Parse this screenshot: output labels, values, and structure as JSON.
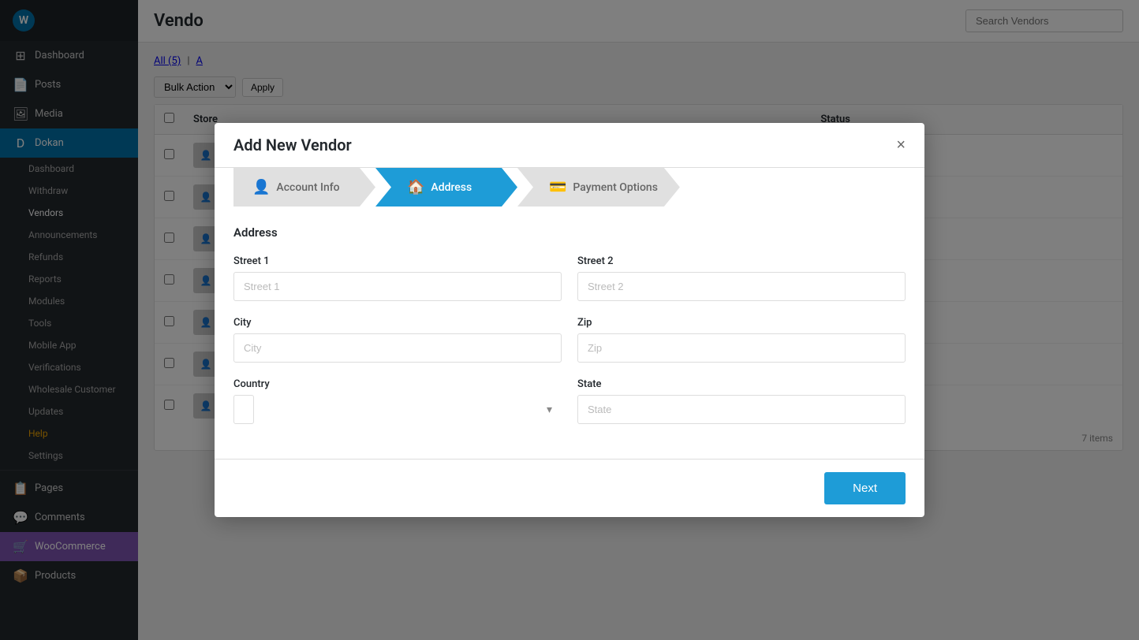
{
  "sidebar": {
    "logo": "W",
    "app_name": "WordPress",
    "items": [
      {
        "id": "dashboard",
        "icon": "⊞",
        "label": "Dashboard",
        "active": false
      },
      {
        "id": "posts",
        "icon": "📄",
        "label": "Posts",
        "active": false
      },
      {
        "id": "media",
        "icon": "🖼",
        "label": "Media",
        "active": false
      },
      {
        "id": "dokan",
        "icon": "D",
        "label": "Dokan",
        "active": true
      },
      {
        "id": "sub-dashboard",
        "label": "Dashboard",
        "sub": true,
        "active": false
      },
      {
        "id": "sub-withdraw",
        "label": "Withdraw",
        "sub": true,
        "active": false
      },
      {
        "id": "sub-vendors",
        "label": "Vendors",
        "sub": true,
        "active": true
      },
      {
        "id": "sub-announcements",
        "label": "Announcements",
        "sub": true,
        "active": false
      },
      {
        "id": "sub-refunds",
        "label": "Refunds",
        "sub": true,
        "active": false
      },
      {
        "id": "sub-reports",
        "label": "Reports",
        "sub": true,
        "active": false
      },
      {
        "id": "sub-modules",
        "label": "Modules",
        "sub": true,
        "active": false
      },
      {
        "id": "sub-tools",
        "label": "Tools",
        "sub": true,
        "active": false
      },
      {
        "id": "sub-mobile",
        "label": "Mobile App",
        "sub": true,
        "active": false
      },
      {
        "id": "sub-verifications",
        "label": "Verifications",
        "sub": true,
        "active": false
      },
      {
        "id": "sub-wholesale",
        "label": "Wholesale Customer",
        "sub": true,
        "active": false
      },
      {
        "id": "sub-updates",
        "label": "Updates",
        "sub": true,
        "active": false
      },
      {
        "id": "sub-help",
        "label": "Help",
        "sub": true,
        "active": false,
        "special": "orange"
      },
      {
        "id": "sub-settings",
        "label": "Settings",
        "sub": true,
        "active": false
      },
      {
        "id": "pages",
        "icon": "📋",
        "label": "Pages",
        "active": false
      },
      {
        "id": "comments",
        "icon": "💬",
        "label": "Comments",
        "active": false
      },
      {
        "id": "woocommerce",
        "icon": "🛒",
        "label": "WooCommerce",
        "active": false,
        "woo": true
      },
      {
        "id": "products",
        "icon": "📦",
        "label": "Products",
        "active": false
      }
    ]
  },
  "topbar": {
    "title": "Vendo",
    "search_placeholder": "Search Vendors",
    "items_count": "7 items"
  },
  "filter_bar": {
    "all_label": "All (5)",
    "separator": "|",
    "second_label": "A"
  },
  "bulk_action": {
    "select_label": "Bulk Action",
    "apply_label": "Apply"
  },
  "table": {
    "columns": [
      "",
      "Store",
      "",
      "Status"
    ],
    "footer_count": "7 items",
    "rows": [
      {
        "id": 1,
        "store": "",
        "status": "on"
      },
      {
        "id": 2,
        "store": "",
        "status": "on"
      },
      {
        "id": 3,
        "store": "",
        "status": "on"
      },
      {
        "id": 4,
        "store": "",
        "status": "on"
      },
      {
        "id": 5,
        "store": "",
        "status": "on"
      },
      {
        "id": 6,
        "store": "",
        "status": "off"
      },
      {
        "id": 7,
        "store": "",
        "status": "off"
      }
    ]
  },
  "modal": {
    "title": "Add New Vendor",
    "close_label": "×",
    "steps": [
      {
        "id": "account-info",
        "icon": "👤",
        "label": "Account Info",
        "active": false
      },
      {
        "id": "address",
        "icon": "🏠",
        "label": "Address",
        "active": true
      },
      {
        "id": "payment-options",
        "icon": "💳",
        "label": "Payment Options",
        "active": false
      }
    ],
    "section_title": "Address",
    "form": {
      "street1_label": "Street 1",
      "street1_placeholder": "Street 1",
      "street2_label": "Street 2",
      "street2_placeholder": "Street 2",
      "city_label": "City",
      "city_placeholder": "City",
      "zip_label": "Zip",
      "zip_placeholder": "Zip",
      "country_label": "Country",
      "country_placeholder": "",
      "state_label": "State",
      "state_placeholder": "State"
    },
    "next_button": "Next"
  },
  "colors": {
    "primary": "#1e9cd7",
    "sidebar_bg": "#23282d",
    "active_item": "#0073aa",
    "dokan_active": "#0073aa",
    "toggle_on": "#00a0d2",
    "toggle_off": "#aaa",
    "help_color": "#f0a500"
  }
}
